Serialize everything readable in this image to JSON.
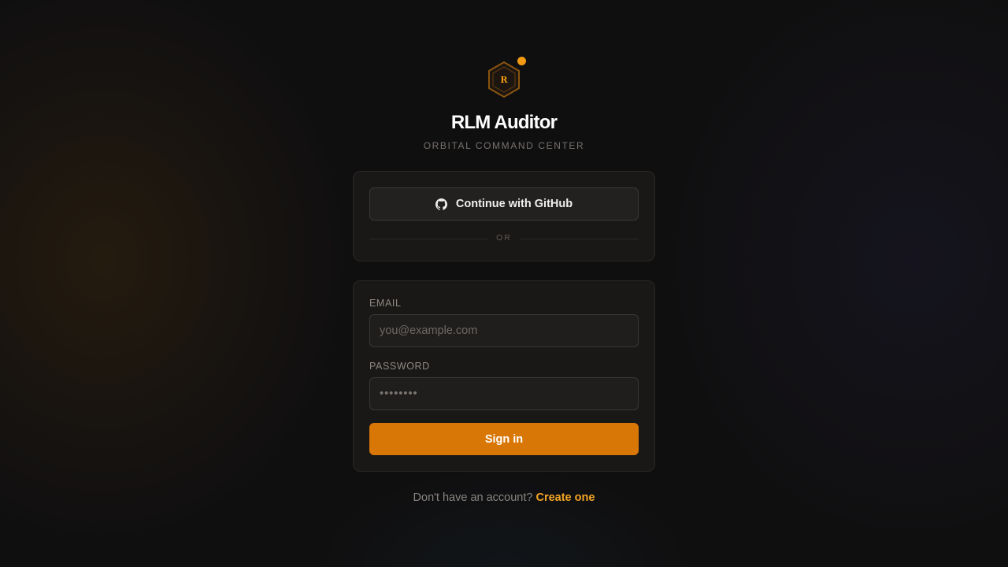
{
  "brand": {
    "logo_letter": "R",
    "title": "RLM Auditor",
    "subtitle": "ORBITAL COMMAND CENTER",
    "accent_color": "#d97706",
    "link_color": "#f5a524",
    "logo_icon": "hexagon-logo-icon",
    "status_dot_color": "#f39a12"
  },
  "oauth": {
    "github_label": "Continue with GitHub",
    "github_icon": "github-icon",
    "divider_text": "OR"
  },
  "form": {
    "email_label": "EMAIL",
    "email_placeholder": "you@example.com",
    "email_value": "",
    "password_label": "PASSWORD",
    "password_placeholder": "••••••••",
    "password_value": "",
    "submit_label": "Sign in"
  },
  "footer": {
    "prompt": "Don't have an account?",
    "link_label": "Create one"
  }
}
